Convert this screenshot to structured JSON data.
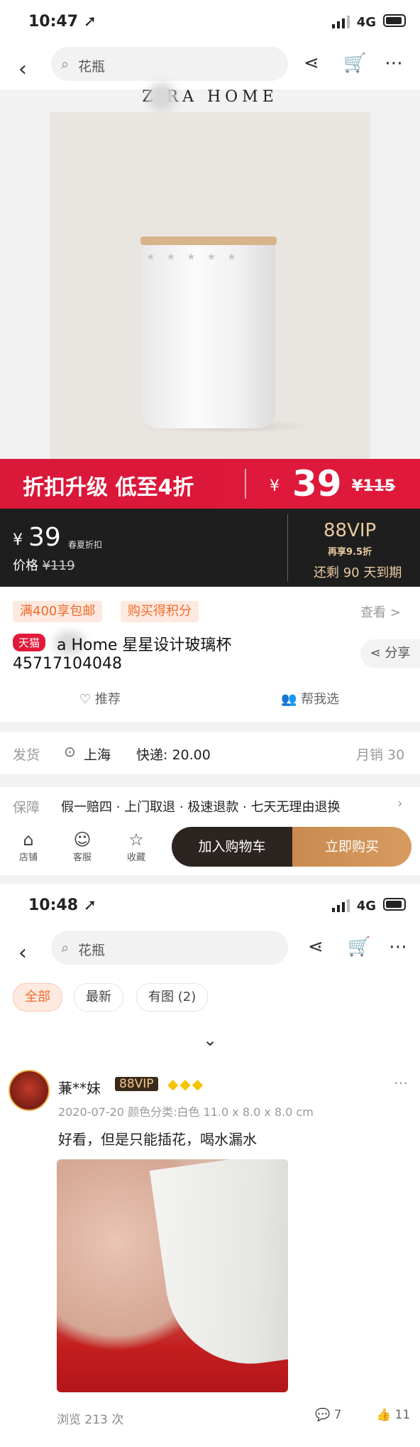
{
  "screen1": {
    "status": {
      "time": "10:47 ➚",
      "network": "4G"
    },
    "nav": {
      "back_icon": "chevron-left-icon",
      "search_placeholder": "花瓶"
    },
    "brand": "Z  RA HOME",
    "promo": {
      "text": "折扣升级 低至4折",
      "currency": "¥",
      "price": "39",
      "original": "¥115"
    },
    "vip_band": {
      "currency": "¥",
      "price": "39",
      "price_label": "春夏折扣",
      "price_line_prefix": "价格",
      "price_line_old": "¥119",
      "vip": "88VIP",
      "vip_discount": "再享9.5折",
      "vip_expire": "还剩 90 天到期"
    },
    "tags": [
      "满400享包邮",
      "购买得积分"
    ],
    "view_all": "查看 >",
    "tmall_badge": "天猫",
    "title_line1": "a Home 星星设计玻璃杯",
    "title_line2": "45717104048",
    "share": "分享",
    "recommend": "推荐",
    "help_choose": "帮我选",
    "shipping": {
      "label": "发货",
      "city": "上海",
      "express": "快递: 20.00",
      "monthly": "月销 30"
    },
    "guarantee": {
      "label": "保障",
      "text": "假一赔四 · 上门取退 · 极速退款 · 七天无理由退换"
    },
    "bottom": {
      "store": "店铺",
      "service": "客服",
      "favorite": "收藏",
      "add_cart": "加入购物车",
      "buy_now": "立即购买"
    }
  },
  "screen2": {
    "status": {
      "time": "10:48 ➚",
      "network": "4G"
    },
    "nav": {
      "search_placeholder": "花瓶"
    },
    "filters": [
      "全部",
      "最新",
      "有图 (2)"
    ],
    "review": {
      "user": "蒹**妹",
      "vip": "88VIP",
      "gems": "◆◆◆",
      "meta": "2020-07-20  颜色分类:白色 11.0 x 8.0 x 8.0 cm",
      "text": "好看，但是只能插花，喝水漏水",
      "views": "浏览 213 次",
      "comments": "7",
      "likes": "11"
    }
  }
}
